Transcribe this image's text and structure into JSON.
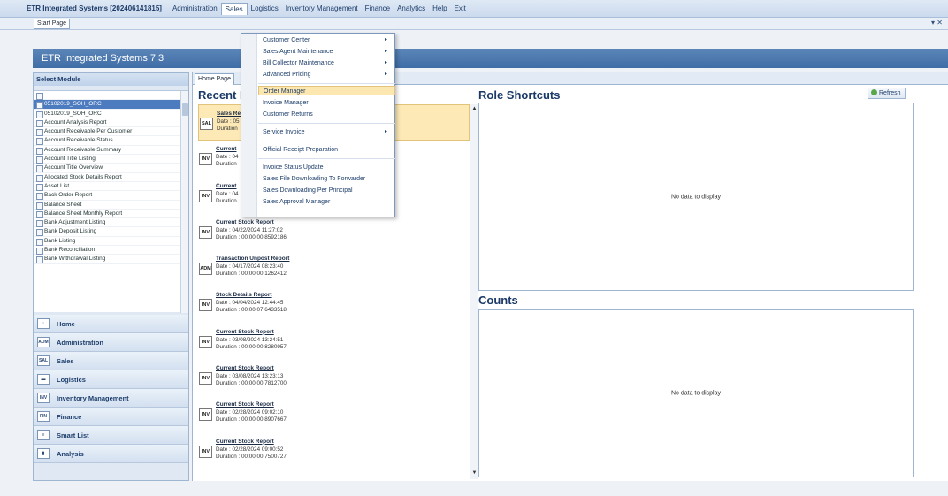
{
  "menubar": {
    "app_title": "ETR Integrated Systems [202406141815]",
    "items": [
      "Administration",
      "Sales",
      "Logistics",
      "Inventory Management",
      "Finance",
      "Analytics",
      "Help",
      "Exit"
    ]
  },
  "startbar": {
    "tab": "Start Page",
    "win_ctrl": "▾ ✕"
  },
  "header": {
    "title": "ETR Integrated Systems 7.3"
  },
  "left_panel": {
    "title": "Select Module",
    "modules": [
      "05102019_SOH_ORC",
      "05102019_SOH_ORC",
      "Account Analysis Report",
      "Account Receivable Per Customer",
      "Account Receivable Status",
      "Account Receivable Summary",
      "Account Title Listing",
      "Account Title Overview",
      "Allocated Stock Details Report",
      "Asset List",
      "Back Order Report",
      "Balance Sheet",
      "Balance Sheet Monthly Report",
      "Bank Adjustment Listing",
      "Bank Deposit Listing",
      "Bank Listing",
      "Bank Reconciliation",
      "Bank Withdrawal Listing"
    ],
    "nav": [
      {
        "label": "Home",
        "icon": "⌂"
      },
      {
        "label": "Administration",
        "icon": "ADM"
      },
      {
        "label": "Sales",
        "icon": "SAL"
      },
      {
        "label": "Logistics",
        "icon": "▬"
      },
      {
        "label": "Inventory Management",
        "icon": "INV"
      },
      {
        "label": "Finance",
        "icon": "FIN"
      },
      {
        "label": "Smart List",
        "icon": "≡"
      },
      {
        "label": "Analysis",
        "icon": "▮"
      }
    ]
  },
  "content": {
    "tab": "Home Page",
    "recent_title": "Recent R",
    "recent": [
      {
        "name": "Sales Re",
        "date": "Date : 05",
        "duration": "Duration",
        "icon": "SAL",
        "highlight": true
      },
      {
        "name": "Current",
        "date": "Date : 04",
        "duration": "Duration",
        "icon": "INV"
      },
      {
        "name": "Current",
        "date": "Date : 04",
        "duration": "Duration",
        "icon": "INV"
      },
      {
        "name": "Current Stock Report",
        "date": "Date : 04/22/2024 11:27:02",
        "duration": "Duration : 00:00:00.8592186",
        "icon": "INV"
      },
      {
        "name": "Transaction Unpost Report",
        "date": "Date : 04/17/2024 08:23:40",
        "duration": "Duration : 00:00:00.1262412",
        "icon": "ADM"
      },
      {
        "name": "Stock Details Report",
        "date": "Date : 04/04/2024 12:44:45",
        "duration": "Duration : 00:00:07.6433518",
        "icon": "INV"
      },
      {
        "name": "Current Stock Report",
        "date": "Date : 03/08/2024 13:24:51",
        "duration": "Duration : 00:00:00.8280957",
        "icon": "INV"
      },
      {
        "name": "Current Stock Report",
        "date": "Date : 03/08/2024 13:23:13",
        "duration": "Duration : 00:00:00.7812700",
        "icon": "INV"
      },
      {
        "name": "Current Stock Report",
        "date": "Date : 02/28/2024 09:02:10",
        "duration": "Duration : 00:00:00.8907667",
        "icon": "INV"
      },
      {
        "name": "Current Stock Report",
        "date": "Date : 02/28/2024 09:00:52",
        "duration": "Duration : 00:00:00.7500727",
        "icon": "INV"
      }
    ],
    "role_title": "Role Shortcuts",
    "refresh_label": "Refresh",
    "role_empty": "No data to display",
    "counts_title": "Counts",
    "counts_empty": "No data to display"
  },
  "dropdown": {
    "items": [
      {
        "label": "Customer Center",
        "submenu": true
      },
      {
        "label": "Sales Agent Maintenance",
        "submenu": true
      },
      {
        "label": "Bill Collector Maintenance",
        "submenu": true
      },
      {
        "label": "Advanced Pricing",
        "submenu": true
      },
      {
        "label": "Order Manager",
        "submenu": false,
        "highlight": true
      },
      {
        "label": "Invoice Manager",
        "submenu": false
      },
      {
        "label": "Customer Returns",
        "submenu": false
      },
      {
        "label": "Service Invoice",
        "submenu": true
      },
      {
        "label": "Official Receipt Preparation",
        "submenu": false
      },
      {
        "label": "Invoice Status Update",
        "submenu": false
      },
      {
        "label": "Sales File Downloading To Forwarder",
        "submenu": false
      },
      {
        "label": "Sales Downloading Per Principal",
        "submenu": false
      },
      {
        "label": "Sales Approval Manager",
        "submenu": false
      }
    ]
  }
}
